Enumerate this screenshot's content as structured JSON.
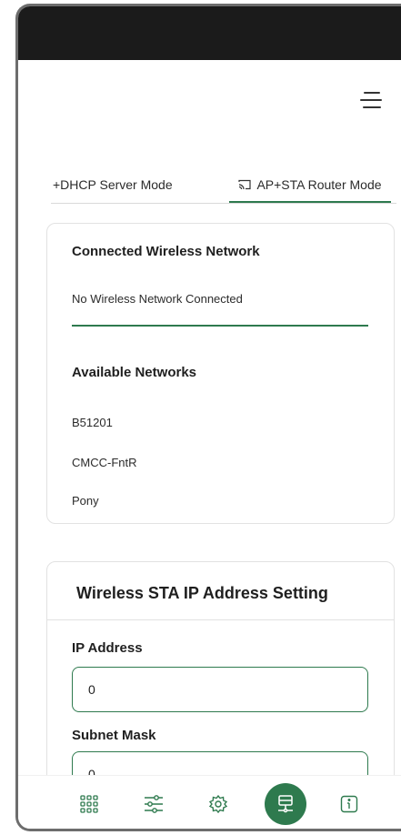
{
  "tabs": [
    {
      "label": "+DHCP Server Mode",
      "active": false
    },
    {
      "label": "AP+STA Router Mode",
      "active": true
    }
  ],
  "connected": {
    "heading": "Connected Wireless Network",
    "status": "No Wireless Network Connected"
  },
  "available": {
    "heading": "Available Networks",
    "networks": [
      "B51201",
      "CMCC-FntR",
      "Pony"
    ]
  },
  "sta": {
    "title": "Wireless STA IP Address Setting",
    "ip_label": "IP Address",
    "ip_value": "0",
    "subnet_label": "Subnet Mask",
    "subnet_value": "0"
  },
  "nav": {
    "items": [
      {
        "icon": "grid-icon",
        "active": false
      },
      {
        "icon": "sliders-icon",
        "active": false
      },
      {
        "icon": "gear-icon",
        "active": false
      },
      {
        "icon": "network-icon",
        "active": true
      },
      {
        "icon": "info-icon",
        "active": false
      }
    ]
  },
  "colors": {
    "accent": "#2e7a4e",
    "statusbar": "#1b1b1b",
    "frame": "#6d6d6d"
  }
}
